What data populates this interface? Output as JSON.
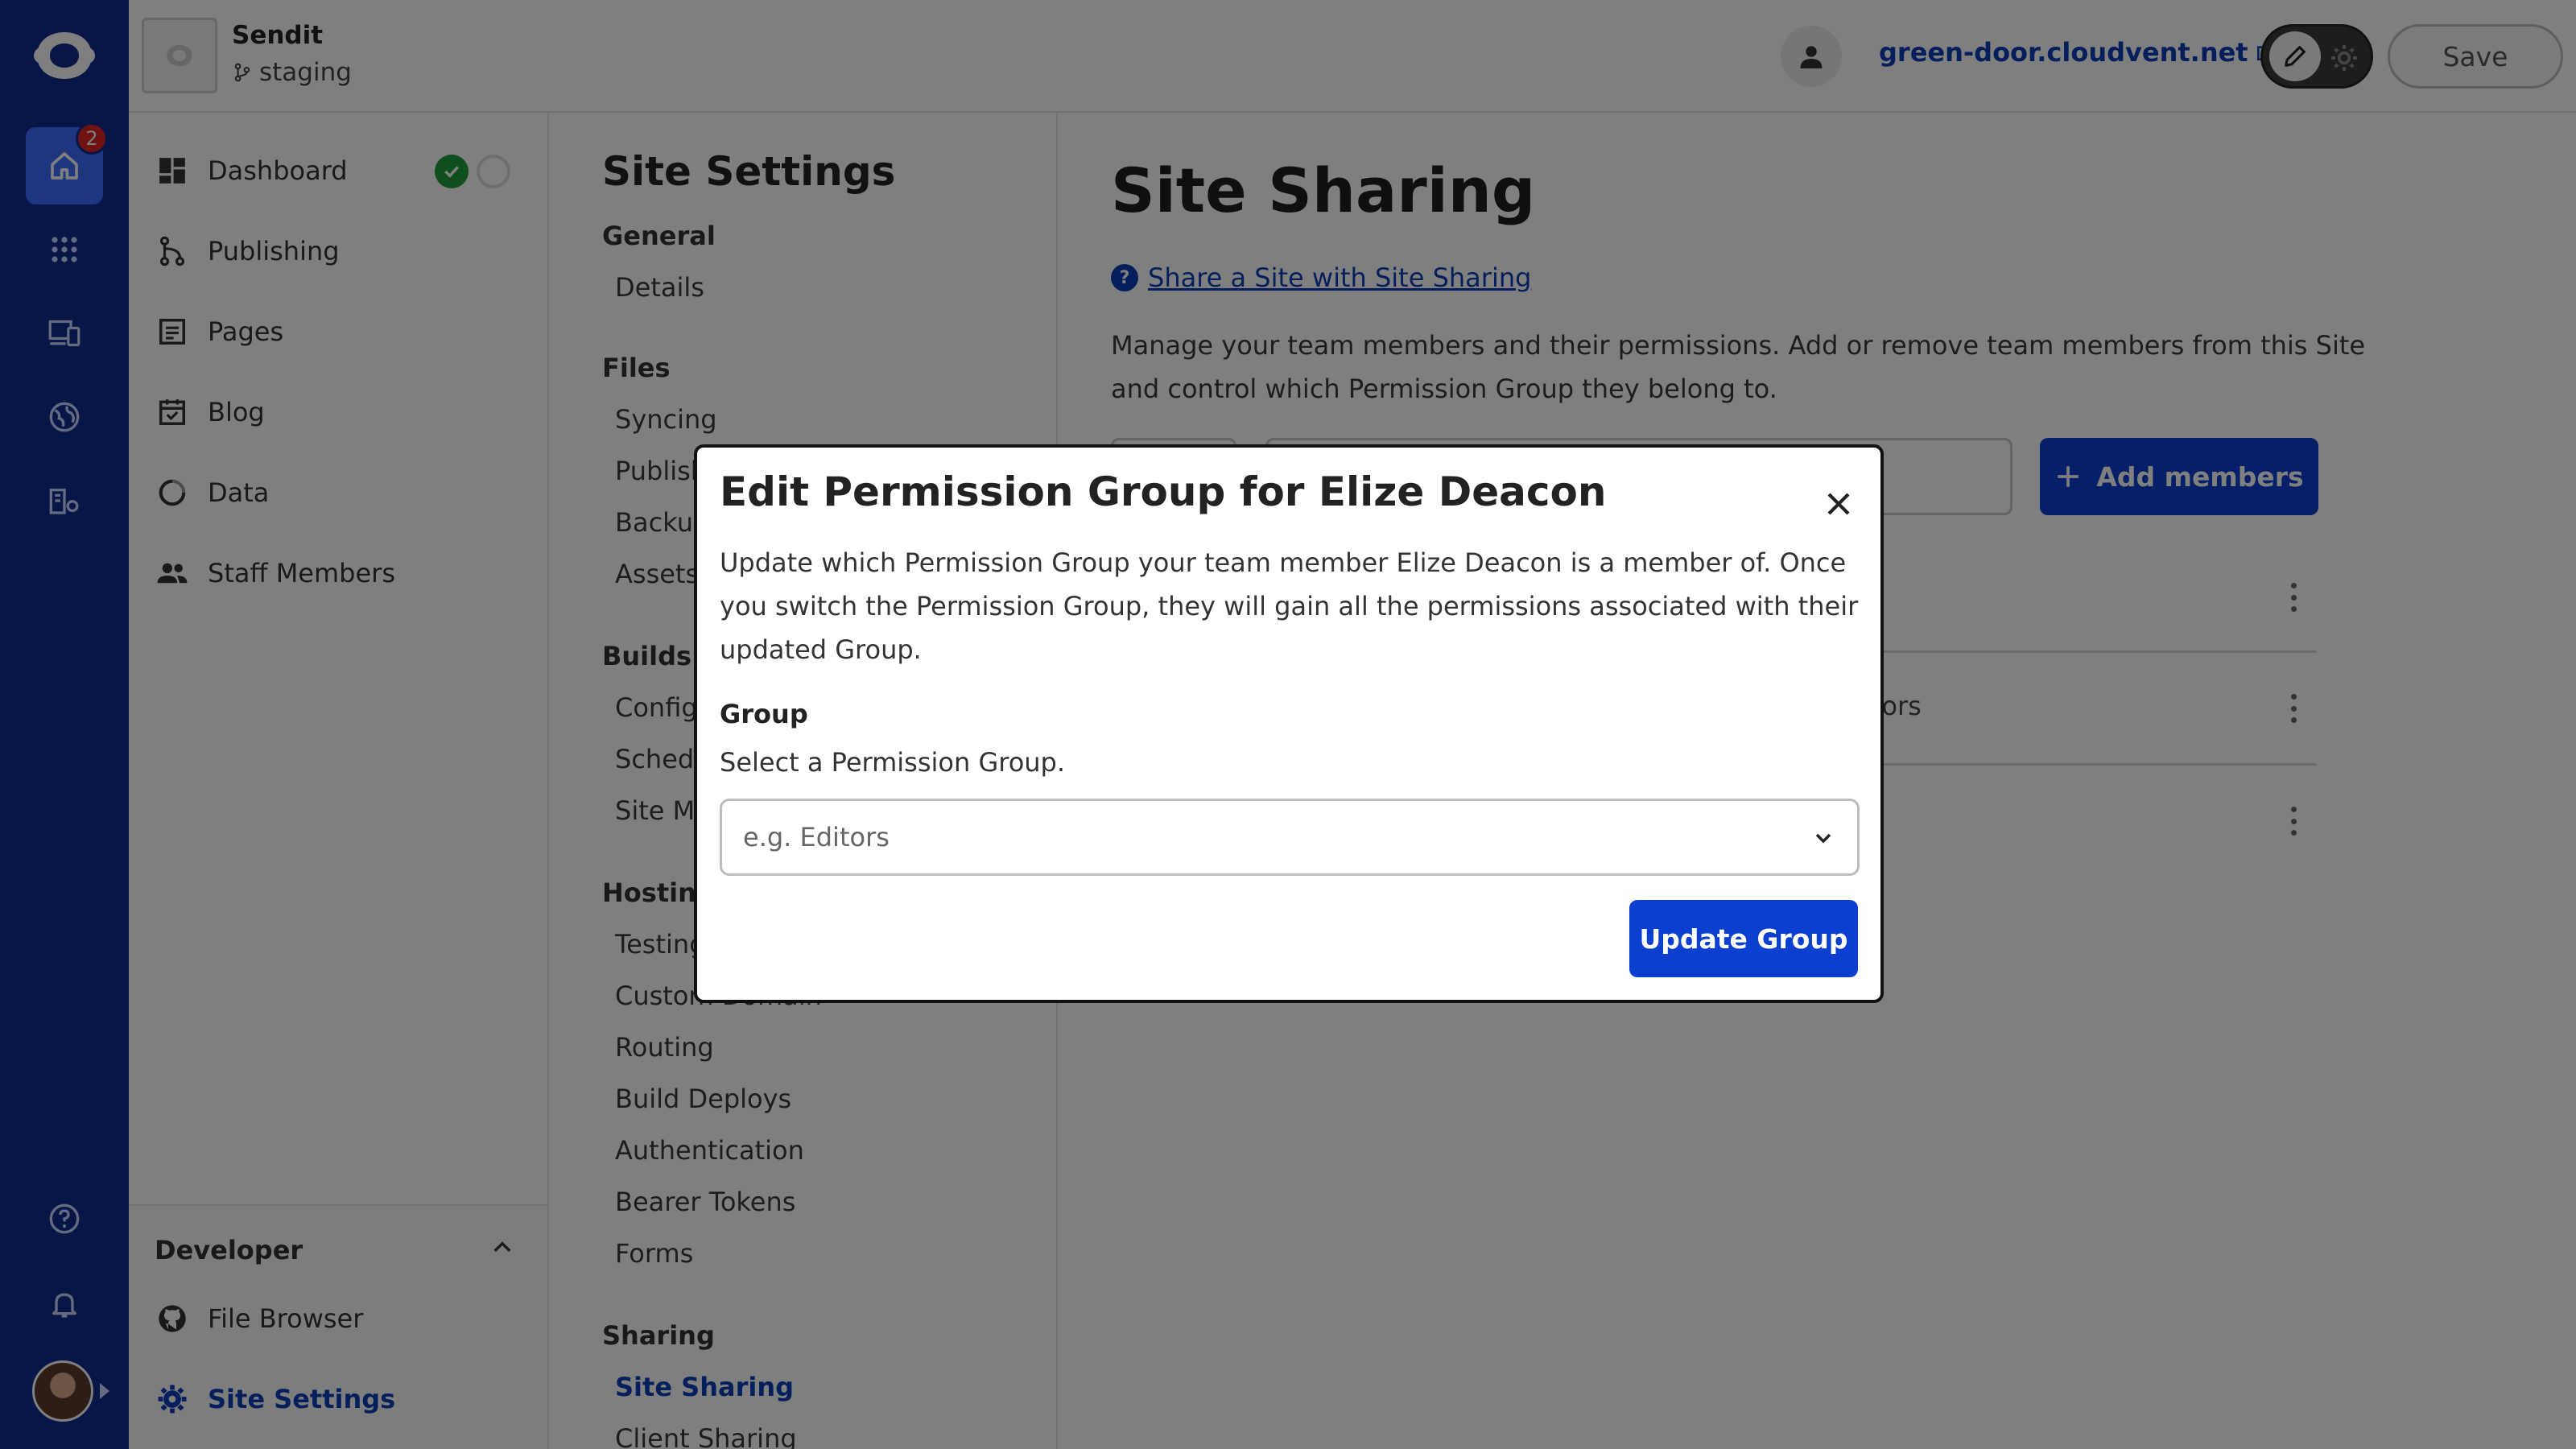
{
  "app": {
    "site_name": "Sendit",
    "branch": "staging",
    "domain": "green-door.cloudvent.net",
    "save_label": "Save",
    "notification_count": "2"
  },
  "sidebar": {
    "items": [
      {
        "label": "Dashboard",
        "icon": "dashboard-icon"
      },
      {
        "label": "Publishing",
        "icon": "publishing-icon"
      },
      {
        "label": "Pages",
        "icon": "pages-icon"
      },
      {
        "label": "Blog",
        "icon": "blog-icon"
      },
      {
        "label": "Data",
        "icon": "data-icon"
      },
      {
        "label": "Staff Members",
        "icon": "staff-icon"
      }
    ],
    "developer": {
      "title": "Developer",
      "items": [
        {
          "label": "File Browser",
          "icon": "github-icon"
        },
        {
          "label": "Site Settings",
          "icon": "gear-icon"
        }
      ]
    }
  },
  "settings": {
    "title": "Site Settings",
    "sections": [
      {
        "heading": "General",
        "links": [
          "Details"
        ]
      },
      {
        "heading": "Files",
        "links": [
          "Syncing",
          "Publish",
          "Backup",
          "Assets"
        ]
      },
      {
        "heading": "Builds",
        "links": [
          "Config",
          "Schedu",
          "Site Mo"
        ]
      },
      {
        "heading": "Hosting",
        "links": [
          "Testing",
          "Custom Domain",
          "Routing",
          "Build Deploys",
          "Authentication",
          "Bearer Tokens",
          "Forms"
        ]
      },
      {
        "heading": "Sharing",
        "links": [
          "Site Sharing",
          "Client Sharing"
        ]
      }
    ]
  },
  "main": {
    "title": "Site Sharing",
    "help_link": "Share a Site with Site Sharing",
    "description": "Manage your team members and their permissions. Add or remove team members from this Site and control which Permission Group they belong to.",
    "add_members_label": "Add members",
    "row_partial_text": "itors"
  },
  "modal": {
    "title": "Edit Permission Group for Elize Deacon",
    "description": "Update which Permission Group your team member Elize Deacon is a member of. Once you switch the Permission Group, they will gain all the permissions associated with their updated Group.",
    "field_label": "Group",
    "field_help": "Select a Permission Group.",
    "select_placeholder": "e.g. Editors",
    "submit_label": "Update Group"
  }
}
